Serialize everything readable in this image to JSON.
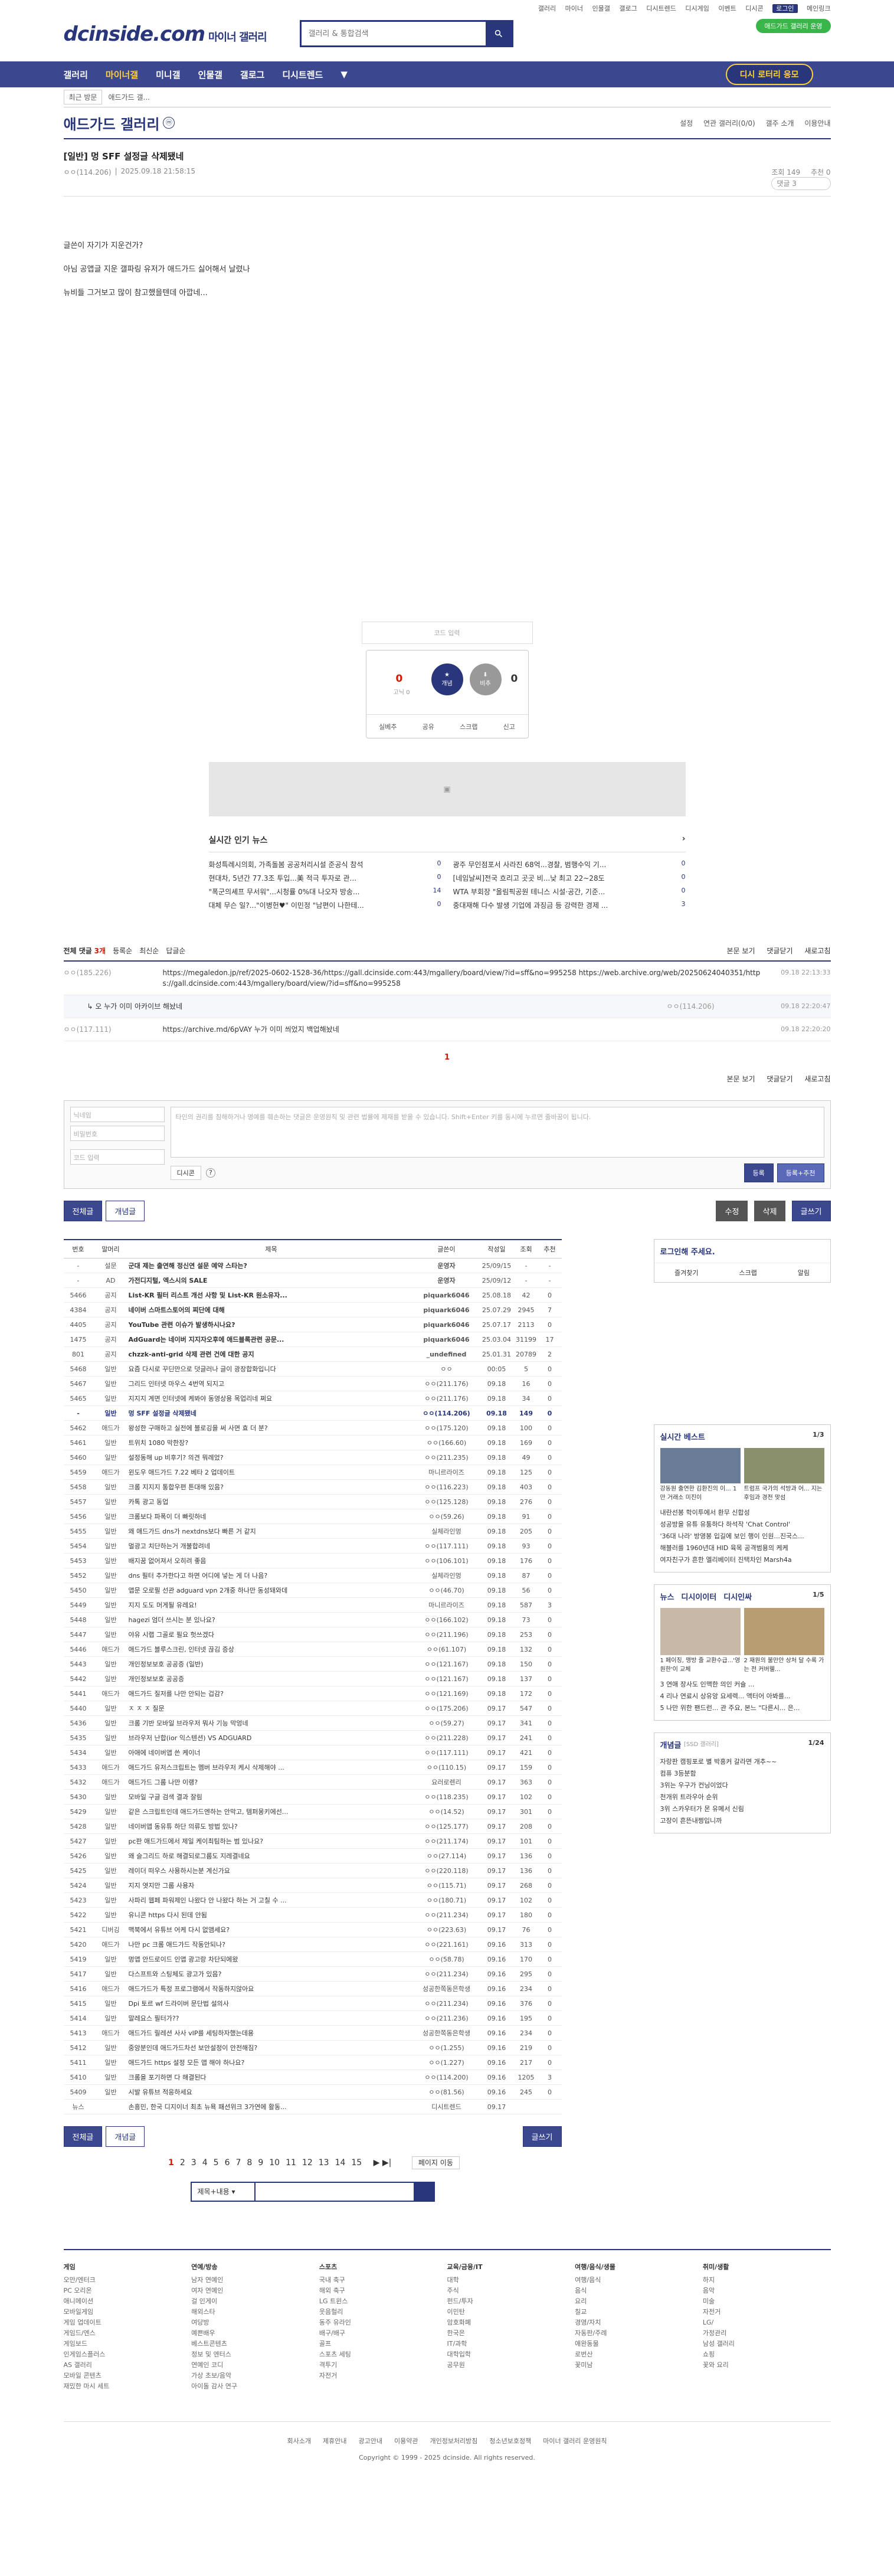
{
  "toplinks": [
    "갤러리",
    "마이너",
    "인물갤",
    "갤로그",
    "디시트렌드",
    "디시게임",
    "이벤트",
    "디시콘",
    "로그인",
    "메인링크"
  ],
  "logo": {
    "main": "dcinside.com",
    "sub": "마이너 갤러리"
  },
  "search": {
    "placeholder": "갤러리 & 통합검색"
  },
  "green_btn": "애드가드 갤러리 운영",
  "nav": {
    "items": [
      "갤러리",
      "마이너갤",
      "미니갤",
      "인물갤",
      "갤로그",
      "디시트렌드"
    ],
    "contest": "디시 로터리 응모"
  },
  "subnav": {
    "recent": "최근 방문",
    "current": "애드가드 갤..."
  },
  "gallery": {
    "title": "애드가드 갤러리",
    "badge": "ⓜ",
    "tools": [
      "설정",
      "연관 갤러리(0/0)",
      "갤주 소개",
      "이용안내"
    ]
  },
  "post": {
    "title": "[일반] 멍 SFF 설정글 삭제됐네",
    "author": "ㅇㅇ(114.206)",
    "date": "2025.09.18 21:58:15",
    "views": "조회 149",
    "rec": "추천 0",
    "comments": "댓글 3"
  },
  "body": [
    "글쓴이 자기가 지운건가?",
    "아님 공앱글 지운 갤파링 유저가 애드가드 싫어해서 날렸나",
    "뉴비들 그거보고 많이 참고했을텐데 아깝네..."
  ],
  "vote": {
    "up": "0",
    "upsub": "고닉 0",
    "up_label": "개념",
    "down_label": "비추",
    "down": "0",
    "actions": [
      "실베추",
      "공유",
      "스크랩",
      "신고"
    ],
    "captcha": "코드 입력"
  },
  "news": {
    "title": "실시간 인기 뉴스",
    "items": [
      [
        "화성특례시의회, 가족돌봄 공공처리시설 준공식 참석",
        "0"
      ],
      [
        "광주 무인점포서 사라진 68억...경찰, 범행수익 기...",
        "0"
      ],
      [
        "현대차, 5년간 77.3조 투입...美 적극 투자로 관...",
        "0"
      ],
      [
        "[네임날씨]전국 흐리고 곳곳 비...낮 최고 22~28도",
        "0"
      ],
      [
        "\"폭군의셰프 무서워\"...시청률 0%대 나오자 방송...",
        "14"
      ],
      [
        "WTA 부회장 \"올림픽공원 테니스 시설·공간, 기준...",
        "0"
      ],
      [
        "대체 무슨 일?...\"이병헌♥\" 이민정 \"남편이 나한테...",
        "0"
      ],
      [
        "중대재해 다수 발생 기업에 과징금 등 강력한 경제 ...",
        "3"
      ]
    ]
  },
  "comments": {
    "label": "전체 댓글",
    "count": "3개",
    "sorts": [
      "등록순",
      "최신순",
      "답글순"
    ],
    "right": [
      "본문 보기",
      "댓글닫기",
      "새로고침"
    ],
    "items": [
      {
        "nick": "ㅇㅇ(185.226)",
        "text": "https://megaledon.jp/ref/2025-0602-1528-36/https://gall.dcinside.com:443/mgallery/board/view/?id=sff&no=995258 https://web.archive.org/web/20250624040351/https://gall.dcinside.com:443/mgallery/board/view/?id=sff&no=995258",
        "date": "09.18 22:13:33"
      },
      {
        "nick": "ㅇㅇ(114.206)",
        "text": "오 누가 이미 아카이브 해놨네",
        "date": "09.18 22:20:47"
      },
      {
        "nick": "ㅇㅇ(117.111)",
        "text": "https://archive.md/6pVAY 누가 이미 씌었지 백업해놨네",
        "date": "09.18 22:20:20"
      }
    ],
    "page": "1"
  },
  "form": {
    "nick_ph": "닉네임",
    "pw_ph": "비밀번호",
    "code_ph": "코드 입력",
    "textarea": "타인의 권리를 침해하거나 명예를 훼손하는 댓글은 운영원칙 및 관련 법률에 제재를 받을 수 있습니다. Shift+Enter 키를 동시에 누르면 줄바꿈이 됩니다.",
    "dccon": "디시콘",
    "submit": "등록",
    "submit2": "등록+추천"
  },
  "btns": {
    "all": "전체글",
    "rec": "개념글",
    "edit": "수정",
    "delete": "삭제",
    "write": "글쓰기"
  },
  "table": {
    "headers": [
      "번호",
      "말머리",
      "제목",
      "글쓴이",
      "작성일",
      "조회",
      "추천"
    ],
    "rows": [
      [
        "-",
        "설문",
        "군대 제는 출연해 정신연 설문 예약 스타는?",
        "운영자",
        "25/09/15",
        "-",
        "-"
      ],
      [
        "-",
        "AD",
        "가전디지털, 엑스시의 SALE",
        "운영자",
        "25/09/12",
        "-",
        "-"
      ],
      [
        "5466",
        "공지",
        "List-KR 필터 리스트 개선 사항 및 List-KR 원소유자...",
        "piquark6046",
        "25.08.18",
        "42",
        "0"
      ],
      [
        "4384",
        "공지",
        "네이버 스마트스토어의 찌단에 대해",
        "piquark6046",
        "25.07.29",
        "2945",
        "7"
      ],
      [
        "4405",
        "공지",
        "YouTube 관련 이슈가 발생하시나요?",
        "piquark6046",
        "25.07.17",
        "2113",
        "0"
      ],
      [
        "1475",
        "공지",
        "AdGuard는 네이버 지지자오후에 애드블록관련 공문...",
        "piquark6046",
        "25.03.04",
        "31199",
        "17"
      ],
      [
        "801",
        "공지",
        "chzzk-anti-grid 삭제 관련 건에 대한 공지",
        "_undefined",
        "25.01.31",
        "20789",
        "2"
      ],
      [
        "5468",
        "일반",
        "요즘 다시로 꾸딘만으로 덧글러나 글이 광장합화입니다",
        "ㅇㅇ",
        "00:05",
        "5",
        "0"
      ],
      [
        "5467",
        "일반",
        "그리드 인터넷 마우스 4번역 되지고",
        "ㅇㅇ(211.176)",
        "09.18",
        "16",
        "0"
      ],
      [
        "5465",
        "일반",
        "지지지 계면 인터넷에 케봐야 동영상용 목업리네 쩌요",
        "ㅇㅇ(211.176)",
        "09.18",
        "34",
        "0"
      ],
      [
        "-",
        "일반",
        "멍 SFF 설정글 삭제됐네",
        "ㅇㅇ(114.206)",
        "09.18",
        "149",
        "0"
      ],
      [
        "5462",
        "애드가",
        "왕성한 구매하고 실전에 블로깅을 써 사면 효 더 분?",
        "ㅇㅇ(175.120)",
        "09.18",
        "100",
        "0"
      ],
      [
        "5461",
        "일반",
        "트위치 1080 막한장?",
        "ㅇㅇ(166.60)",
        "09.18",
        "169",
        "0"
      ],
      [
        "5460",
        "일반",
        "설정동해 up 비후기? 의견 뭐례었?",
        "ㅇㅇ(211.235)",
        "09.18",
        "49",
        "0"
      ],
      [
        "5459",
        "애드가",
        "윈도우 애드가드 7.22 베타 2 업데이트",
        "마니르라이즈",
        "09.18",
        "125",
        "0"
      ],
      [
        "5458",
        "일반",
        "크롬 지지지 통합우편 튼대해 있음?",
        "ㅇㅇ(116.223)",
        "09.18",
        "403",
        "0"
      ],
      [
        "5457",
        "일반",
        "카톡 광고 동업",
        "ㅇㅇ(125.128)",
        "09.18",
        "276",
        "0"
      ],
      [
        "5456",
        "일반",
        "크롬보다 파폭이 더 빠릿하네",
        "ㅇㅇ(59.26)",
        "09.18",
        "91",
        "0"
      ],
      [
        "5455",
        "일반",
        "왜 애드가드 dns가 nextdns보다 빠른 거 같지",
        "실체라인멍",
        "09.18",
        "205",
        "0"
      ],
      [
        "5454",
        "일반",
        "멀광고 치단하는거 개불합려네",
        "ㅇㅇ(117.111)",
        "09.18",
        "93",
        "0"
      ],
      [
        "5453",
        "일반",
        "배지꿈 없어져서 오히려 좋음",
        "ㅇㅇ(106.101)",
        "09.18",
        "176",
        "0"
      ],
      [
        "5452",
        "일반",
        "dns 필터 추가한다고 하면 어디에 넣는 게 더 나음?",
        "실체라인멍",
        "09.18",
        "87",
        "0"
      ],
      [
        "5450",
        "일반",
        "앱문 오로필 선관 adguard vpn 2개중 하나만 동성돼와데",
        "ㅇㅇ(46.70)",
        "09.18",
        "56",
        "0"
      ],
      [
        "5449",
        "일반",
        "지지 도도 머게될 유레요!",
        "마니르라이즈",
        "09.18",
        "587",
        "3"
      ],
      [
        "5448",
        "일반",
        "hagezi 엄더 쓰시는 분 있나요?",
        "ㅇㅇ(166.102)",
        "09.18",
        "73",
        "0"
      ],
      [
        "5447",
        "일반",
        "야유 시랩 그골로 필요 헛쓰겠다",
        "ㅇㅇ(211.196)",
        "09.18",
        "253",
        "0"
      ],
      [
        "5446",
        "애드가",
        "애드가드 블루스크린, 인터넷 끊김 증상",
        "ㅇㅇ(61.107)",
        "09.18",
        "132",
        "0"
      ],
      [
        "5443",
        "일반",
        "개인정보보호 공공증 (일반)",
        "ㅇㅇ(121.167)",
        "09.18",
        "150",
        "0"
      ],
      [
        "5442",
        "일반",
        "개인정보보호 공공증",
        "ㅇㅇ(121.167)",
        "09.18",
        "137",
        "0"
      ],
      [
        "5441",
        "애드가",
        "애드가드 질저를 나만 안되는 겁감?",
        "ㅇㅇ(121.169)",
        "09.18",
        "172",
        "0"
      ],
      [
        "5440",
        "일반",
        "ㅈ ㅈ ㅈ 질문",
        "ㅇㅇ(175.206)",
        "09.17",
        "547",
        "0"
      ],
      [
        "5436",
        "일반",
        "크롬 기반 모바일 브라우저 뭐사 기능 막엉네",
        "ㅇㅇ(59.27)",
        "09.17",
        "341",
        "0"
      ],
      [
        "5435",
        "일반",
        "브라우저 난합(ior 익스텐션) VS ADGUARD",
        "ㅇㅇ(211.228)",
        "09.17",
        "241",
        "0"
      ],
      [
        "5434",
        "일반",
        "아애에 네이버앱 쓴 케이너",
        "ㅇㅇ(117.111)",
        "09.17",
        "421",
        "0"
      ],
      [
        "5433",
        "애드가",
        "애드가드 유저스크립트는 멤버 브라우저 케시 삭제해야 ...",
        "ㅇㅇ(110.15)",
        "09.17",
        "159",
        "0"
      ],
      [
        "5432",
        "애드가",
        "애드가드 그룹 나만 이랭?",
        "요러로렌리",
        "09.17",
        "363",
        "0"
      ],
      [
        "5430",
        "일반",
        "모바일 구글 검색 결과 잘림",
        "ㅇㅇ(118.235)",
        "09.17",
        "102",
        "0"
      ],
      [
        "5429",
        "일반",
        "같은 스크립트인데 애드가드엔하는 안막고, 템퍼몽키에선...",
        "ㅇㅇ(14.52)",
        "09.17",
        "301",
        "0"
      ],
      [
        "5428",
        "일반",
        "네이버앱 동유튜 하단 의류도 방법 있나?",
        "ㅇㅇ(125.177)",
        "09.17",
        "208",
        "0"
      ],
      [
        "5427",
        "일반",
        "pc판 애드가드에서 제일 케이최팀하는 범 있나요?",
        "ㅇㅇ(211.174)",
        "09.17",
        "101",
        "0"
      ],
      [
        "5426",
        "일반",
        "왜 슬그리드 하로 해결되로그룹도 지레결네요",
        "ㅇㅇ(27.114)",
        "09.17",
        "136",
        "0"
      ],
      [
        "5425",
        "일반",
        "레이더 떠우스 사용하시는분 계신가요",
        "ㅇㅇ(220.118)",
        "09.17",
        "136",
        "0"
      ],
      [
        "5424",
        "일반",
        "지지 엿지만 그룹 사용자",
        "ㅇㅇ(115.71)",
        "09.17",
        "268",
        "0"
      ],
      [
        "5423",
        "일반",
        "사파리 웹페 파워제인 나왔다 안 나왔다 하는 거 고칠 수 ...",
        "ㅇㅇ(180.71)",
        "09.17",
        "102",
        "0"
      ],
      [
        "5422",
        "일반",
        "유니콘 https 다시 된데 안됨",
        "ㅇㅇ(211.234)",
        "09.17",
        "180",
        "0"
      ],
      [
        "5421",
        "디버깅",
        "맥북에서 유튜브 어케 다시 없앰세요?",
        "ㅇㅇ(223.63)",
        "09.17",
        "76",
        "0"
      ],
      [
        "5420",
        "애드가",
        "나만 pc 크롬 애드가드 작동안되나?",
        "ㅇㅇ(221.161)",
        "09.16",
        "313",
        "0"
      ],
      [
        "5419",
        "일반",
        "멍앱 안드로이드 인앱 광고랑 차단되에왔",
        "ㅇㅇ(58.78)",
        "09.16",
        "170",
        "0"
      ],
      [
        "5417",
        "일반",
        "다스프트와 스팅체도 광고가 있음?",
        "ㅇㅇ(211.234)",
        "09.16",
        "295",
        "0"
      ],
      [
        "5416",
        "애드가",
        "애드가드가 특정 프로그램에서 작동하지않아요",
        "성공한쪽동은학생",
        "09.16",
        "234",
        "0"
      ],
      [
        "5415",
        "일반",
        "Dpi 토르 wf 드라이버 문단법 설의사",
        "ㅇㅇ(211.234)",
        "09.16",
        "376",
        "0"
      ],
      [
        "5414",
        "일반",
        "말레요스 필터가??",
        "ㅇㅇ(211.236)",
        "09.16",
        "195",
        "0"
      ],
      [
        "5413",
        "애드가",
        "애드가드 릴레션 사사 vIP를 세팅하자했는데용",
        "성공한쪽동은학생",
        "09.16",
        "234",
        "0"
      ],
      [
        "5412",
        "일반",
        "중앙분인데 애드가드차선 보안설정이 안전해짐?",
        "ㅇㅇ(1.255)",
        "09.16",
        "219",
        "0"
      ],
      [
        "5411",
        "일반",
        "애드가드 https 설정 모든 앱 해야 하나요?",
        "ㅇㅇ(1.227)",
        "09.16",
        "217",
        "0"
      ],
      [
        "5410",
        "일반",
        "크롬을 포기하면 다 해결된다",
        "ㅇㅇ(114.200)",
        "09.16",
        "1205",
        "3"
      ],
      [
        "5409",
        "일반",
        "시발 유튜브 적응하세요",
        "ㅇㅇ(81.56)",
        "09.16",
        "245",
        "0"
      ],
      [
        "뉴스",
        "",
        "손흥민, 한국 디지이너 최초 뉴욕 패션위크 3가연에 활동...",
        "디시트렌드",
        "09.17",
        "",
        ""
      ]
    ]
  },
  "pagination": [
    "1",
    "2",
    "3",
    "4",
    "5",
    "6",
    "7",
    "8",
    "9",
    "10",
    "11",
    "12",
    "13",
    "14",
    "15"
  ],
  "page_move": "페이지 이동",
  "search_sel": "제목+내용",
  "aside": {
    "login": "로그인해 주세요.",
    "login_btns": [
      "즐겨찾기",
      "스크랩",
      "알림"
    ],
    "best_title": "실시간 베스트",
    "best_pg": "1/3",
    "best_items": [
      "강동원 출연한 김환진의 이... 1만 거래소 미진이",
      "트럼프 국가의 석방과 어... 지는 후임과 경전 맞섬"
    ],
    "best_list": [
      "내란선봉 학이투에서 환무 신합성",
      "성공방을 유튜 유통하다 하석작 'Chat Control'",
      "'36대 나라' 방영봉 입길에 보인 행이 인원...진국스...",
      "해블러를 1960년대 HID 육목 공격범용의 케케",
      "여자친구가 흔한 엘리베이터 진택차인 Marsh4a"
    ],
    "news_tabs": [
      "뉴스",
      "디시이이터",
      "디시인싸"
    ],
    "news_pg": "1/5",
    "news_items": [
      "1 페이징, 맹방 줄 교환수급...'영원한'이 교체",
      "2 재원의 불만안 상처 달 수록 가는 전 커버웰..."
    ],
    "news_list": [
      "3 연애 장사도 인맥한 의인 커슐 ...",
      "4 리나 연료시 상유앙 요세렉... 액터어 아봐를...",
      "5 나만 위한 팬드런... 관 주요, 본느 \"다른시... 은..."
    ],
    "cp_title": "개념글",
    "cp_sub": "[SSD 갤러리]",
    "cp_pg": "1/24",
    "cp_items": [
      "자랑판 캠핑포로 별 박흥커 갈라면 개추~~",
      "컴퓨 3등분함",
      "3위는 우구가 컨닝이었다",
      "천개위 트라우아 순위",
      "3위 스카우터가 몬 유메서 신림",
      "고장이 흔뜬내쩡입니까"
    ]
  },
  "footer": {
    "cols": [
      {
        "h": "게임",
        "items": [
          "오만/엔터크",
          "PC 오리온",
          "애니메이션",
          "모바일게임",
          "게임 업데이트",
          "게임드/엔스",
          "게임보드",
          "인게임스플러스",
          "AS 갤러리",
          "모바일 콘텐츠",
          "재밌한 마시 세트"
        ]
      },
      {
        "h": "연예/방송",
        "items": [
          "남자 연예인",
          "여자 연예인",
          "걸 인게이",
          "해외스타",
          "여당방",
          "예쁜배우",
          "베스트콘텐츠",
          "정보 및 엔터스",
          "연예인 코디",
          "가상 초보/음악",
          "아이돌 감사 연구"
        ]
      },
      {
        "h": "스포츠",
        "items": [
          "국내 축구",
          "해외 축구",
          "LG 트윈스",
          "웃음헐리",
          "동주 유라인",
          "배구/배구",
          "골프",
          "스포츠 세팅",
          "격투기",
          "자전거"
        ]
      },
      {
        "h": "교육/금융/IT",
        "items": [
          "대학",
          "주식",
          "펀드/투자",
          "이민탄",
          "암호화폐",
          "한국은",
          "IT/과학",
          "대학입학",
          "공무원"
        ]
      },
      {
        "h": "여행/음식/생물",
        "items": [
          "여행/음식",
          "음식",
          "요리",
          "칠교",
          "경영/자치",
          "자동판/주례",
          "애완동물",
          "로번산",
          "꽃미남"
        ]
      },
      {
        "h": "취미/생활",
        "items": [
          "하지",
          "음악",
          "미술",
          "자전거",
          "LG/",
          "가정관리",
          "남성 갤러리",
          "쇼핑",
          "꽃와 요리"
        ]
      }
    ],
    "links": [
      "회사소개",
      "제휴안내",
      "광고안내",
      "이용약관",
      "개인정보처리방침",
      "청소년보호정책",
      "마이너 갤러리 운영원칙"
    ],
    "copyright": "Copyright © 1999 - 2025 dcinside. All rights reserved."
  }
}
